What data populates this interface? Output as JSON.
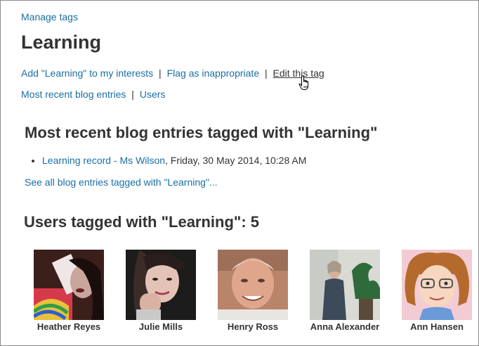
{
  "nav": {
    "manage_tags": "Manage tags"
  },
  "tag": {
    "title": "Learning"
  },
  "actions": {
    "add_interest": "Add \"Learning\" to my interests",
    "flag": "Flag as inappropriate",
    "edit": "Edit this tag",
    "separator": "|"
  },
  "subnav": {
    "recent_entries": "Most recent blog entries",
    "users": "Users",
    "separator": "|"
  },
  "blog": {
    "heading": "Most recent blog entries tagged with \"Learning\"",
    "entries": [
      {
        "title": "Learning record",
        "author": "Ms Wilson",
        "date": "Friday, 30 May 2014, 10:28 AM"
      }
    ],
    "see_all": "See all blog entries tagged with \"Learning\"..."
  },
  "users_section": {
    "heading": "Users tagged with \"Learning\": 5",
    "users": [
      {
        "name": "Heather Reyes"
      },
      {
        "name": "Julie Mills"
      },
      {
        "name": "Henry Ross"
      },
      {
        "name": "Anna Alexander"
      },
      {
        "name": "Ann Hansen"
      }
    ]
  },
  "colors": {
    "link": "#1a6fa3",
    "text": "#333333",
    "border": "#8a8a8a"
  },
  "icons": {
    "cursor": "hand-pointer-icon"
  }
}
